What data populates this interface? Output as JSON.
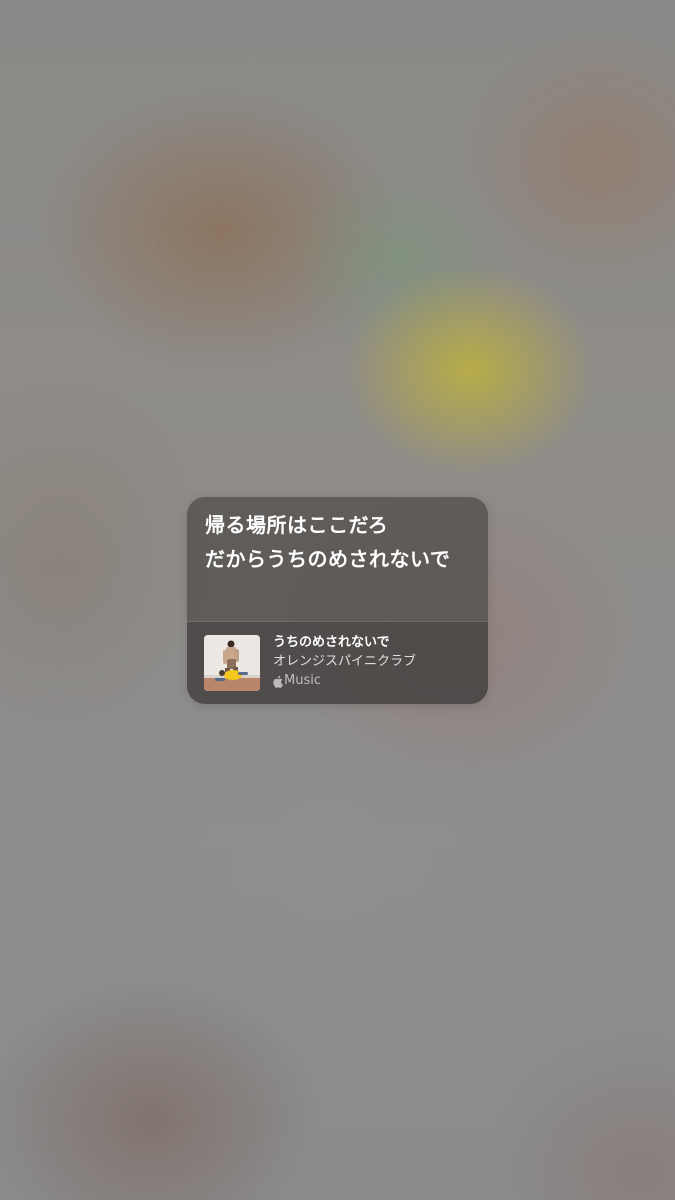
{
  "share_card": {
    "lyrics": [
      "帰る場所はここだろ",
      "だからうちのめされないで"
    ],
    "track": {
      "title": "うちのめされないで",
      "artist": "オレンジスパイニクラブ",
      "service": "Music",
      "service_icon": "apple-logo-icon",
      "artwork_icon": "album-artwork"
    }
  }
}
